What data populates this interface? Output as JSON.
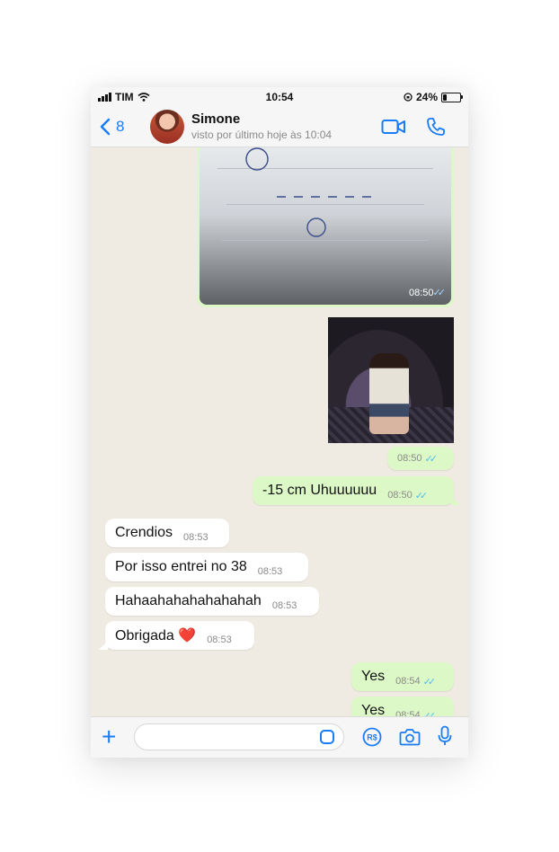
{
  "status_bar": {
    "carrier": "TIM",
    "time": "10:54",
    "battery": "24%",
    "battery_level": 0.24
  },
  "header": {
    "back_count": "8",
    "contact_name": "Simone",
    "last_seen": "visto por último hoje às 10:04",
    "icons": [
      "back-chevron-icon",
      "video-call-icon",
      "phone-call-icon"
    ]
  },
  "messages": [
    {
      "type": "image",
      "direction": "out",
      "time": "08:50"
    },
    {
      "type": "image",
      "direction": "out"
    },
    {
      "type": "text",
      "direction": "out",
      "text": "",
      "time": "08:50"
    },
    {
      "type": "text",
      "direction": "out",
      "text": "-15 cm Uhuuuuuu",
      "time": "08:50"
    },
    {
      "type": "text",
      "direction": "in",
      "text": "Crendios",
      "time": "08:53"
    },
    {
      "type": "text",
      "direction": "in",
      "text": "Por isso entrei no 38",
      "time": "08:53"
    },
    {
      "type": "text",
      "direction": "in",
      "text": "Hahaahahahahahahah",
      "time": "08:53"
    },
    {
      "type": "text",
      "direction": "in",
      "text": "Obrigada ❤️",
      "time": "08:53"
    },
    {
      "type": "text",
      "direction": "out",
      "text": "Yes",
      "time": "08:54"
    },
    {
      "type": "text",
      "direction": "out",
      "text": "Yes",
      "time": "08:54"
    }
  ],
  "input_bar": {
    "placeholder": "",
    "icons": [
      "plus-icon",
      "sticker-icon",
      "payment-rs-icon",
      "camera-icon",
      "microphone-icon"
    ],
    "rs_label": "R$"
  },
  "colors": {
    "accent": "#1a7cf6",
    "bubble_out": "#dcf8c6",
    "bubble_in": "#ffffff",
    "chat_bg": "#efeae2",
    "read_ticks": "#53bdeb"
  }
}
